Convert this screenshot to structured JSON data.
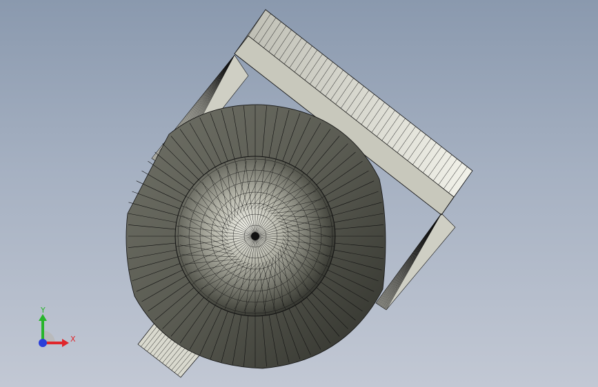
{
  "viewport": {
    "colors": {
      "background_top": "#8a99ae",
      "background_bottom": "#c2c8d4",
      "body_dark": "#3e3f38",
      "body_mid": "#8c8c80",
      "body_light": "#dadacf",
      "flange_face": "#c8c8bc",
      "mesh_line": "#111111"
    }
  },
  "triad": {
    "x_label": "X",
    "y_label": "Y",
    "x_color": "#e0262b",
    "y_color": "#27b52c",
    "z_color": "#2a3fd9"
  }
}
